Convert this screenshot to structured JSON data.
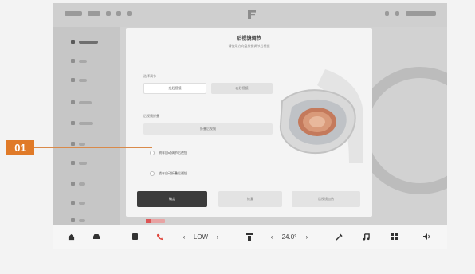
{
  "callout": {
    "number": "01"
  },
  "dialog": {
    "title": "后视镜调节",
    "subtitle": "请使用方向盘按键调节后视镜",
    "section1_label": "选择调节",
    "segment_options": [
      "左后视镜",
      "右后视镜"
    ],
    "selected_segment": "左后视镜",
    "section2_label": "后视镜折叠",
    "fold_button_label": "折叠后视镜",
    "option1_label": "倒车自动调节后视镜",
    "option2_label": "锁车自动折叠后视镜",
    "btn_confirm": "确定",
    "btn_reset": "恢复",
    "btn_other": "后视镜加热"
  },
  "dock": {
    "fan_label": "LOW",
    "temp_label": "24.0°",
    "left_chevron": "‹",
    "right_chevron": "›"
  },
  "colors": {
    "callout": "#e07a28",
    "dialog_bg": "#f4f4f4",
    "confirm_button": "#3b3b3b",
    "phone_icon": "#e0443a"
  },
  "icons": [
    "home-icon",
    "car-icon",
    "app-icon",
    "phone-icon",
    "fan-icon",
    "wiper-icon",
    "music-icon",
    "apps-grid-icon",
    "volume-icon"
  ]
}
